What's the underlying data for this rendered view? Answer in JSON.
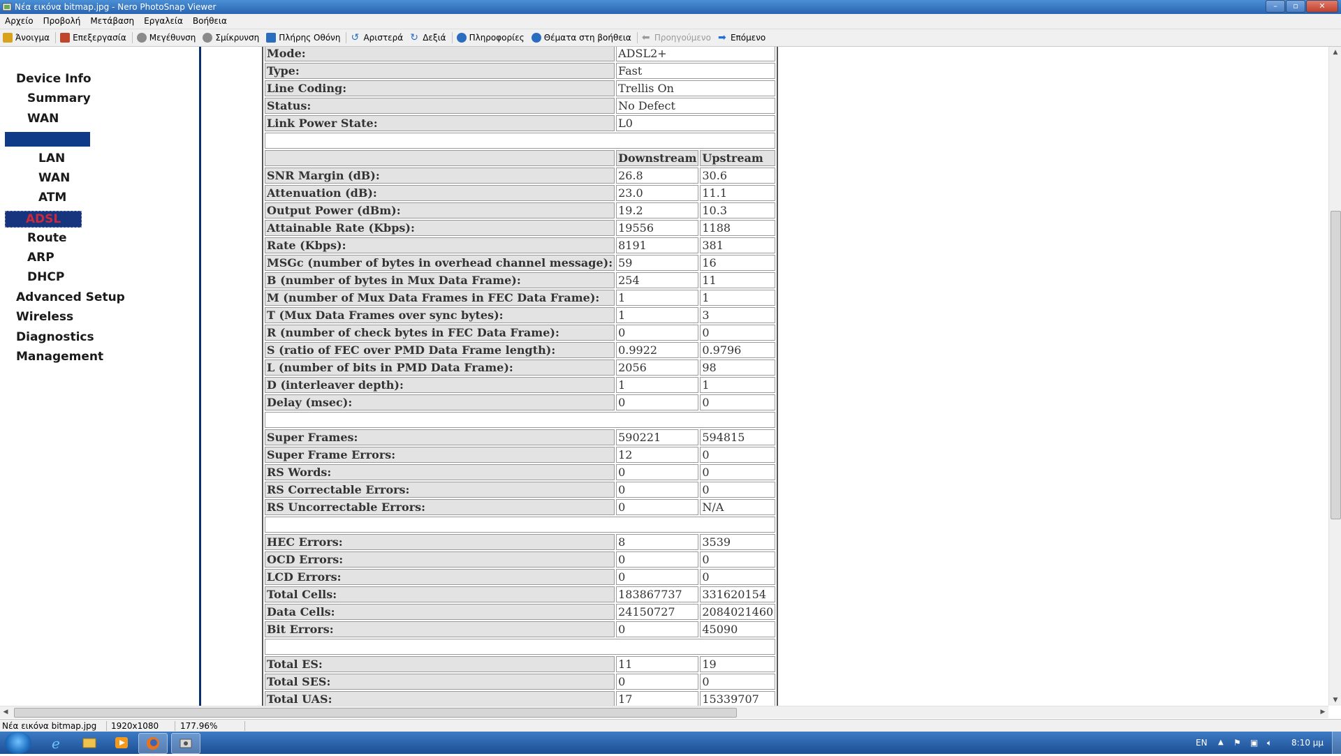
{
  "window": {
    "title": "Νέα εικόνα bitmap.jpg - Nero PhotoSnap Viewer",
    "minimize": "–",
    "maximize": "▫",
    "close": "✕"
  },
  "menu": [
    "Αρχείο",
    "Προβολή",
    "Μετάβαση",
    "Εργαλεία",
    "Βοήθεια"
  ],
  "toolbar": [
    {
      "label": "Άνοιγμα",
      "icon": "folder-open-icon",
      "color": "#d8a21c"
    },
    {
      "label": "Επεξεργασία",
      "icon": "edit-icon",
      "color": "#c0462b"
    },
    {
      "label": "Μεγέθυνση",
      "icon": "zoom-in-icon",
      "color": "#6b6b6b"
    },
    {
      "label": "Σμίκρυνση",
      "icon": "zoom-out-icon",
      "color": "#6b6b6b"
    },
    {
      "label": "Πλήρης Οθόνη",
      "icon": "fullscreen-icon",
      "color": "#2a6cc0"
    },
    {
      "label": "Αριστερά",
      "icon": "rotate-left-icon",
      "color": "#2a6cc0"
    },
    {
      "label": "Δεξιά",
      "icon": "rotate-right-icon",
      "color": "#2a6cc0"
    },
    {
      "label": "Πληροφορίες",
      "icon": "info-icon",
      "color": "#2a6cc0"
    },
    {
      "label": "Θέματα στη βοήθεια",
      "icon": "help-icon",
      "color": "#2a6cc0"
    },
    {
      "label": "Προηγούμενο",
      "icon": "arrow-left-icon",
      "color": "#9a9a9a"
    },
    {
      "label": "Επόμενο",
      "icon": "arrow-right-icon",
      "color": "#1f6fd6"
    }
  ],
  "sidebar": {
    "device_info": "Device Info",
    "summary": "Summary",
    "wan": "WAN",
    "lan": "LAN",
    "wan2": "WAN",
    "atm": "ATM",
    "adsl": "ADSL",
    "route": "Route",
    "arp": "ARP",
    "dhcp": "DHCP",
    "advanced_setup": "Advanced Setup",
    "wireless": "Wireless",
    "diagnostics": "Diagnostics",
    "management": "Management"
  },
  "top_rows": [
    {
      "label": "Mode:",
      "value": "ADSL2+"
    },
    {
      "label": "Type:",
      "value": "Fast"
    },
    {
      "label": "Line Coding:",
      "value": "Trellis On"
    },
    {
      "label": "Status:",
      "value": "No Defect"
    },
    {
      "label": "Link Power State:",
      "value": "L0"
    }
  ],
  "headers": {
    "downstream": "Downstream",
    "upstream": "Upstream"
  },
  "groups": [
    [
      {
        "label": "SNR Margin (dB):",
        "down": "26.8",
        "up": "30.6"
      },
      {
        "label": "Attenuation (dB):",
        "down": "23.0",
        "up": "11.1"
      },
      {
        "label": "Output Power (dBm):",
        "down": "19.2",
        "up": "10.3"
      },
      {
        "label": "Attainable Rate (Kbps):",
        "down": "19556",
        "up": "1188"
      },
      {
        "label": "Rate (Kbps):",
        "down": "8191",
        "up": "381"
      },
      {
        "label": "MSGc (number of bytes in overhead channel message):",
        "down": "59",
        "up": "16"
      },
      {
        "label": "B (number of bytes in Mux Data Frame):",
        "down": "254",
        "up": "11"
      },
      {
        "label": "M (number of Mux Data Frames in FEC Data Frame):",
        "down": "1",
        "up": "1"
      },
      {
        "label": "T (Mux Data Frames over sync bytes):",
        "down": "1",
        "up": "3"
      },
      {
        "label": "R (number of check bytes in FEC Data Frame):",
        "down": "0",
        "up": "0"
      },
      {
        "label": "S (ratio of FEC over PMD Data Frame length):",
        "down": "0.9922",
        "up": "0.9796"
      },
      {
        "label": "L (number of bits in PMD Data Frame):",
        "down": "2056",
        "up": "98"
      },
      {
        "label": "D (interleaver depth):",
        "down": "1",
        "up": "1"
      },
      {
        "label": "Delay (msec):",
        "down": "0",
        "up": "0"
      }
    ],
    [
      {
        "label": "Super Frames:",
        "down": "590221",
        "up": "594815"
      },
      {
        "label": "Super Frame Errors:",
        "down": "12",
        "up": "0"
      },
      {
        "label": "RS Words:",
        "down": "0",
        "up": "0"
      },
      {
        "label": "RS Correctable Errors:",
        "down": "0",
        "up": "0"
      },
      {
        "label": "RS Uncorrectable Errors:",
        "down": "0",
        "up": "N/A"
      }
    ],
    [
      {
        "label": "HEC Errors:",
        "down": "8",
        "up": "3539"
      },
      {
        "label": "OCD Errors:",
        "down": "0",
        "up": "0"
      },
      {
        "label": "LCD Errors:",
        "down": "0",
        "up": "0"
      },
      {
        "label": "Total Cells:",
        "down": "183867737",
        "up": "331620154"
      },
      {
        "label": "Data Cells:",
        "down": "24150727",
        "up": "2084021460"
      },
      {
        "label": "Bit Errors:",
        "down": "0",
        "up": "45090"
      }
    ],
    [
      {
        "label": "Total ES:",
        "down": "11",
        "up": "19"
      },
      {
        "label": "Total SES:",
        "down": "0",
        "up": "0"
      },
      {
        "label": "Total UAS:",
        "down": "17",
        "up": "15339707"
      }
    ]
  ],
  "statusbar": {
    "filename": "Νέα εικόνα bitmap.jpg",
    "dimensions": "1920x1080",
    "zoom": "177.96%"
  },
  "taskbar": {
    "lang": "EN",
    "time": "8:10 μμ"
  }
}
